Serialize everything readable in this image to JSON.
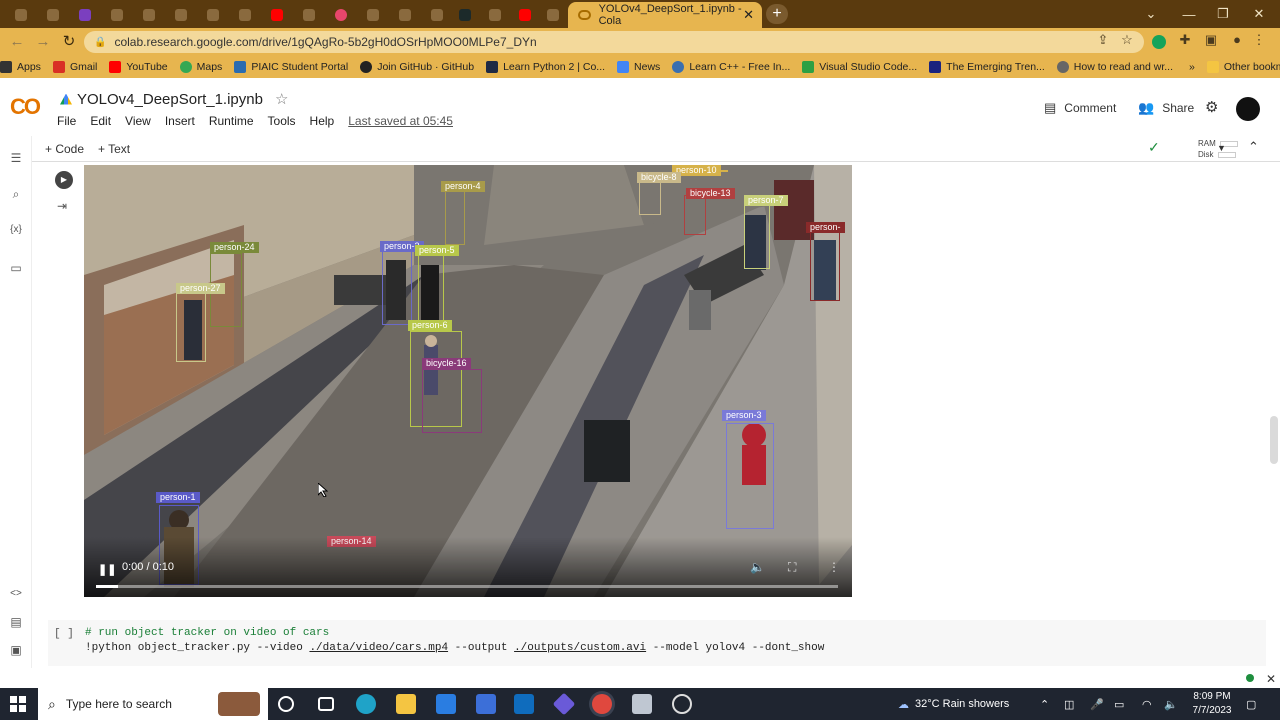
{
  "browser": {
    "active_tab_title": "YOLOv4_DeepSort_1.ipynb - Cola",
    "new_tab_label": "+",
    "url": "colab.research.google.com/drive/1gQAgRo-5b2gH0dOSrHpMOO0MLPe7_DYn",
    "window_controls": {
      "minimize": "—",
      "maximize": "❐",
      "close": "✕",
      "dropdown": "⌄"
    }
  },
  "bookmarks": [
    {
      "label": "Apps",
      "color": "#555555"
    },
    {
      "label": "Gmail",
      "color": "#d93025"
    },
    {
      "label": "YouTube",
      "color": "#ff0000"
    },
    {
      "label": "Maps",
      "color": "#34a853"
    },
    {
      "label": "PIAIC Student Portal",
      "color": "#2b6cb0"
    },
    {
      "label": "Join GitHub · GitHub",
      "color": "#222222"
    },
    {
      "label": "Learn Python 2 | Co...",
      "color": "#1f2a44"
    },
    {
      "label": "News",
      "color": "#4285f4"
    },
    {
      "label": "Learn C++ - Free In...",
      "color": "#3a6fb0"
    },
    {
      "label": "Visual Studio Code...",
      "color": "#2ea043"
    },
    {
      "label": "The Emerging Tren...",
      "color": "#1a237e"
    },
    {
      "label": "How to read and wr...",
      "color": "#666666"
    }
  ],
  "bookmarks_more": "»",
  "bookmarks_other": "Other bookmarks",
  "colab": {
    "logo_a": "C",
    "logo_b": "O",
    "notebook_title": "YOLOv4_DeepSort_1.ipynb",
    "menu": [
      "File",
      "Edit",
      "View",
      "Insert",
      "Runtime",
      "Tools",
      "Help"
    ],
    "last_saved": "Last saved at 05:45",
    "comment_label": "Comment",
    "share_label": "Share",
    "add_code_label": "+ Code",
    "add_text_label": "+ Text",
    "ram_label": "RAM",
    "disk_label": "Disk"
  },
  "video": {
    "time": "0:00 / 0:10",
    "progress_fraction": 0.03,
    "detections": [
      {
        "label": "person-4",
        "color": "#a89b4a"
      },
      {
        "label": "person-10",
        "color": "#d6b24a"
      },
      {
        "label": "bicycle-8",
        "color": "#c9b98a"
      },
      {
        "label": "bicycle-13",
        "color": "#b04040"
      },
      {
        "label": "person-7",
        "color": "#c8d07a"
      },
      {
        "label": "person-",
        "color": "#8a2a2a"
      },
      {
        "label": "person-24",
        "color": "#7a8a3a"
      },
      {
        "label": "person-2",
        "color": "#6a6ac8"
      },
      {
        "label": "person-5",
        "color": "#b8c84a"
      },
      {
        "label": "person-27",
        "color": "#c8c88a"
      },
      {
        "label": "person-6",
        "color": "#b8c84a"
      },
      {
        "label": "bicycle-16",
        "color": "#8a3a7a"
      },
      {
        "label": "person-3",
        "color": "#7a7ad8"
      },
      {
        "label": "person-1",
        "color": "#5a5ac8"
      },
      {
        "label": "person-14",
        "color": "#c84a5a"
      }
    ]
  },
  "code_cell": {
    "bracket": "[ ]",
    "comment": "# run object tracker on video of cars",
    "cmd_a": "!python object_tracker.py --video ",
    "cmd_video": "./data/video/cars.mp4",
    "cmd_b": " --output ",
    "cmd_output": "./outputs/custom.avi",
    "cmd_c": " --model yolov4 --dont_show"
  },
  "taskbar": {
    "search_placeholder": "Type here to search",
    "weather": "32°C  Rain showers",
    "time": "8:09 PM",
    "date": "7/7/2023"
  }
}
